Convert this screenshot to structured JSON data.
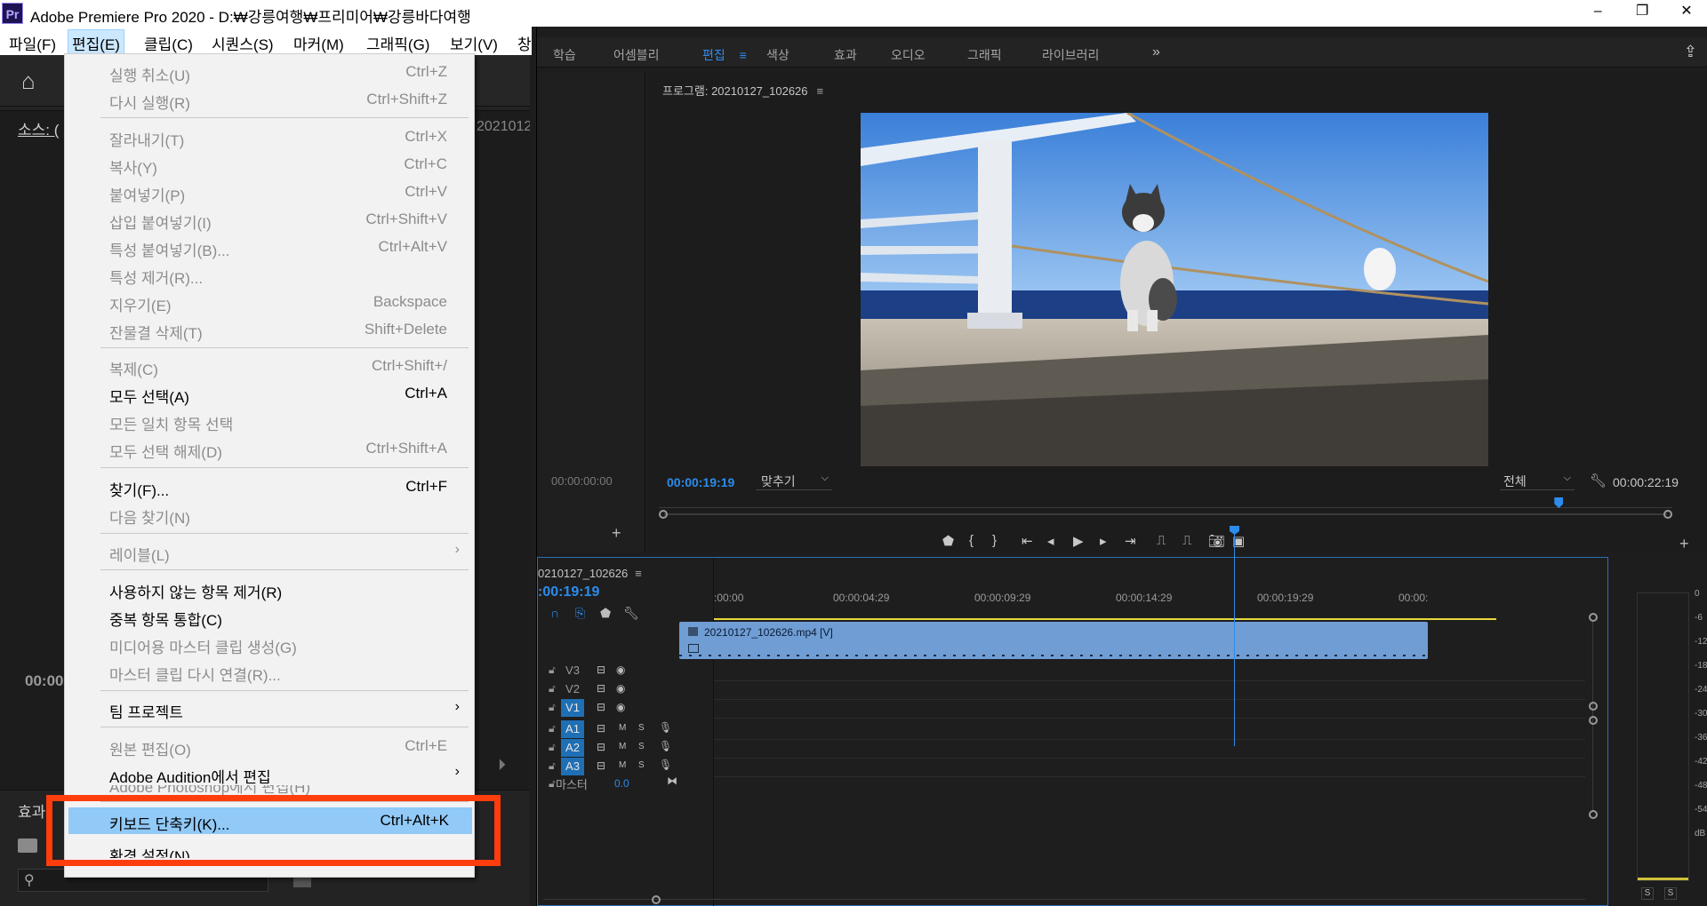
{
  "window": {
    "app_logo": "Pr",
    "title": "Adobe Premiere Pro 2020 - D:₩강릉여행₩프리미어₩강릉바다여행",
    "controls": [
      "–",
      "❐",
      "✕"
    ]
  },
  "menubar": [
    {
      "label": "파일(F)",
      "active": false
    },
    {
      "label": "편집(E)",
      "active": true
    },
    {
      "label": "클립(C)",
      "active": false
    },
    {
      "label": "시퀀스(S)",
      "active": false
    },
    {
      "label": "마커(M)",
      "active": false
    },
    {
      "label": "그래픽(G)",
      "active": false
    },
    {
      "label": "보기(V)",
      "active": false
    },
    {
      "label": "창",
      "active": false
    }
  ],
  "edit_menu": {
    "items": [
      {
        "label": "실행 취소(U)",
        "shortcut": "Ctrl+Z",
        "disabled": true
      },
      {
        "label": "다시 실행(R)",
        "shortcut": "Ctrl+Shift+Z",
        "disabled": true
      },
      {
        "label": "잘라내기(T)",
        "shortcut": "Ctrl+X",
        "disabled": true
      },
      {
        "label": "복사(Y)",
        "shortcut": "Ctrl+C",
        "disabled": true
      },
      {
        "label": "붙여넣기(P)",
        "shortcut": "Ctrl+V",
        "disabled": true
      },
      {
        "label": "삽입 붙여넣기(I)",
        "shortcut": "Ctrl+Shift+V",
        "disabled": true
      },
      {
        "label": "특성 붙여넣기(B)...",
        "shortcut": "Ctrl+Alt+V",
        "disabled": true
      },
      {
        "label": "특성 제거(R)...",
        "shortcut": "",
        "disabled": true
      },
      {
        "label": "지우기(E)",
        "shortcut": "Backspace",
        "disabled": true
      },
      {
        "label": "잔물결 삭제(T)",
        "shortcut": "Shift+Delete",
        "disabled": true
      },
      {
        "label": "복제(C)",
        "shortcut": "Ctrl+Shift+/",
        "disabled": true
      },
      {
        "label": "모두 선택(A)",
        "shortcut": "Ctrl+A",
        "disabled": false
      },
      {
        "label": "모든 일치 항목 선택",
        "shortcut": "",
        "disabled": true
      },
      {
        "label": "모두 선택 해제(D)",
        "shortcut": "Ctrl+Shift+A",
        "disabled": true
      },
      {
        "label": "찾기(F)...",
        "shortcut": "Ctrl+F",
        "disabled": false
      },
      {
        "label": "다음 찾기(N)",
        "shortcut": "",
        "disabled": true
      },
      {
        "label": "레이블(L)",
        "shortcut": "",
        "disabled": true,
        "submenu": true
      },
      {
        "label": "사용하지 않는 항목 제거(R)",
        "shortcut": "",
        "disabled": false
      },
      {
        "label": "중복 항목 통합(C)",
        "shortcut": "",
        "disabled": false
      },
      {
        "label": "미디어용 마스터 클립 생성(G)",
        "shortcut": "",
        "disabled": true
      },
      {
        "label": "마스터 클립 다시 연결(R)...",
        "shortcut": "",
        "disabled": true
      },
      {
        "label": "팀 프로젝트",
        "shortcut": "",
        "disabled": false,
        "submenu": true
      },
      {
        "label": "원본 편집(O)",
        "shortcut": "Ctrl+E",
        "disabled": true
      },
      {
        "label": "Adobe Audition에서 편집",
        "shortcut": "",
        "disabled": false,
        "submenu": true
      },
      {
        "label": "키보드 단축키(K)...",
        "shortcut": "Ctrl+Alt+K",
        "disabled": false,
        "highlight": true
      }
    ],
    "partial_items": [
      "Adobe Photoshop에서 편집(H)",
      "환경 설정(N)"
    ]
  },
  "left_panels": {
    "source_tab": "소스: (",
    "source_clip": "2021012",
    "timecode": "00:00",
    "effects_tab": "효과",
    "effects_tab_short": "검"
  },
  "workspaces": {
    "tabs": [
      "학습",
      "어셈블리",
      "편집",
      "색상",
      "효과",
      "오디오",
      "그래픽",
      "라이브러리"
    ],
    "active": "편집",
    "more": "»"
  },
  "program": {
    "title": "프로그램: 20210127_102626",
    "left_panel_timecode": "00:00:00:00",
    "current_timecode": "00:00:19:19",
    "fit": "맞추기",
    "resolution": "전체",
    "duration": "00:00:22:19",
    "playhead_fraction": 0.888
  },
  "timeline": {
    "sequence_name": "0210127_102626",
    "timecode": ":00:19:19",
    "ruler_labels": [
      ":00:00",
      "00:00:04:29",
      "00:00:09:29",
      "00:00:14:29",
      "00:00:19:29",
      "00:00:"
    ],
    "tracks_video": [
      "V3",
      "V2",
      "V1"
    ],
    "tracks_audio": [
      "A1",
      "A2",
      "A3"
    ],
    "master_label": "마스터",
    "master_value": "0.0",
    "clip_video_label": "20210127_102626.mp4 [V]",
    "mute_label": "M",
    "solo_label": "S"
  },
  "meters": {
    "db_labels": [
      "0",
      "-6",
      "-12",
      "-18",
      "-24",
      "-30",
      "-36",
      "-42",
      "-48",
      "-54",
      "dB"
    ],
    "solo_buttons": [
      "S",
      "S"
    ]
  },
  "colors": {
    "accent_blue": "#2d8ceb",
    "menu_highlight": "#91c9f7",
    "annotation_red": "#ff3d0d",
    "clip_blue": "#6f9dd4"
  }
}
